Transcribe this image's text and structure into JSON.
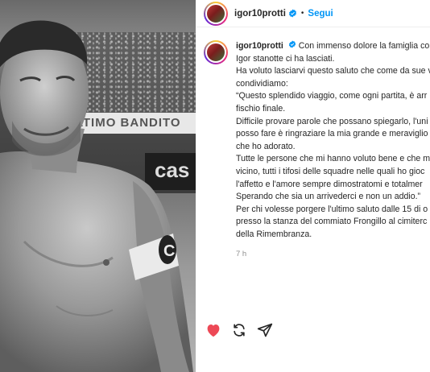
{
  "photo": {
    "banner_text": "ULTIMO BANDITO",
    "sign_text": "cas",
    "captain_text": "C"
  },
  "header": {
    "username": "igor10protti",
    "separator": "•",
    "follow_label": "Segui"
  },
  "post": {
    "username": "igor10protti",
    "lines": [
      "Con immenso dolore la famiglia con",
      "Igor stanotte ci ha lasciati.",
      "Ha voluto lasciarvi questo saluto che come da sue v",
      "condividiamo:",
      "“Questo splendido viaggio, come ogni partita, è arr",
      "fischio finale.",
      "Difficile provare parole che possano spiegarlo, l'uni",
      "posso fare è ringraziare la mia grande e meraviglio",
      "che ho adorato.",
      "Tutte le persone che mi hanno voluto bene e che m",
      "vicino, tutti i tifosi delle squadre nelle quali ho gioc",
      "l'affetto e l'amore sempre dimostratomi e totalmer",
      "Sperando che sia un arrivederci e non un addio.”",
      "Per chi volesse porgere l'ultimo saluto dalle 15 di o",
      "presso la stanza del commiato Frongillo al cimiterc",
      "della Rimembranza."
    ],
    "time": "7 h"
  },
  "colors": {
    "accent": "#0095f6",
    "like": "#ed4956",
    "muted": "#8e8e8e"
  },
  "icons": [
    "verified-badge-icon",
    "heart-icon",
    "repost-icon",
    "share-icon"
  ]
}
